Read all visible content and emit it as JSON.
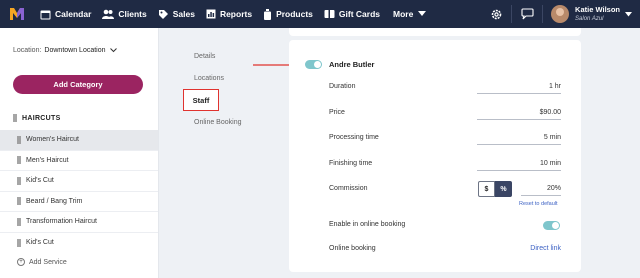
{
  "nav": {
    "items": [
      {
        "label": "Calendar",
        "icon": "calendar-icon"
      },
      {
        "label": "Clients",
        "icon": "clients-icon"
      },
      {
        "label": "Sales",
        "icon": "tag-icon"
      },
      {
        "label": "Reports",
        "icon": "reports-icon"
      },
      {
        "label": "Products",
        "icon": "bottle-icon"
      },
      {
        "label": "Gift Cards",
        "icon": "giftcard-icon"
      }
    ],
    "more_label": "More",
    "user_name": "Katie Wilson",
    "salon_name": "Salon Azul",
    "brand_color": "#1f2a44"
  },
  "sidebar": {
    "location_label": "Location:",
    "location_value": "Downtown Location",
    "add_category_label": "Add Category",
    "category_heading": "HAIRCUTS",
    "services": [
      "Women's Haircut",
      "Men's Haircut",
      "Kid's Cut",
      "Beard / Bang Trim",
      "Transformation Haircut",
      "Kid's Cut"
    ],
    "active_service": "Women's Haircut",
    "add_service_label": "Add Service",
    "accent_color": "#9b2461"
  },
  "subnav": {
    "items": [
      "Details",
      "Locations",
      "Staff",
      "Online Booking"
    ],
    "active": "Staff"
  },
  "staff_panel": {
    "staff_name": "Andre Butler",
    "staff_enabled": true,
    "rows": {
      "duration": {
        "label": "Duration",
        "value": "1 hr"
      },
      "price": {
        "label": "Price",
        "value": "$90.00"
      },
      "processing": {
        "label": "Processing time",
        "value": "5 min"
      },
      "finishing": {
        "label": "Finishing time",
        "value": "10 min"
      },
      "commission": {
        "label": "Commission",
        "value": "20%"
      }
    },
    "commission_toggle": {
      "dollar": "$",
      "percent": "%",
      "selected": "%"
    },
    "reset_label": "Reset to default",
    "online_enable_label": "Enable in online booking",
    "online_enabled": true,
    "online_booking_label": "Online booking",
    "online_booking_link": "Direct link",
    "toggle_color": "#7fc6cc",
    "annotation_color": "#e0332f"
  }
}
